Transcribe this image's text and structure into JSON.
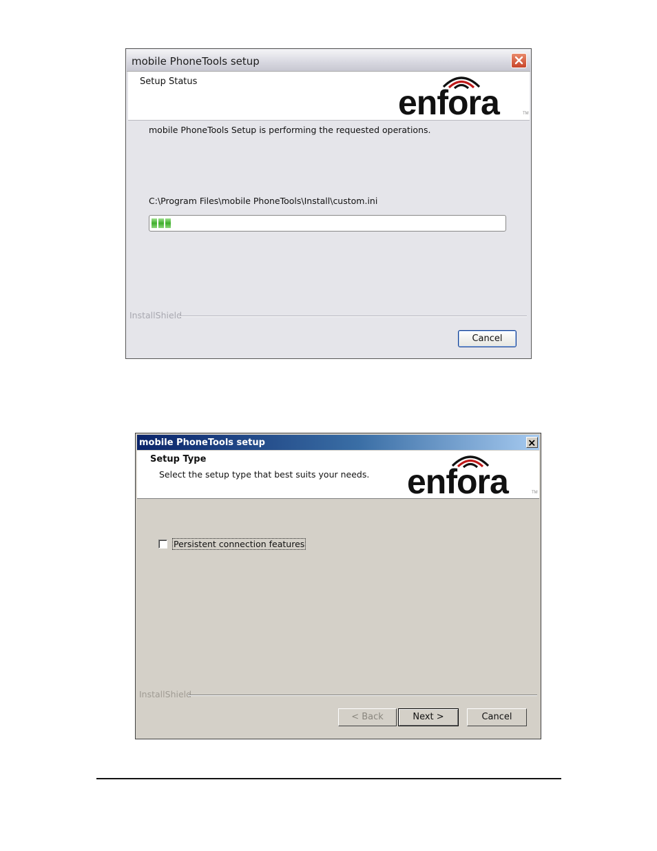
{
  "dialog1": {
    "title": "mobile PhoneTools setup",
    "header_title": "Setup Status",
    "logo_text": "enfora",
    "message": "mobile PhoneTools Setup is performing the requested operations.",
    "current_file": "C:\\Program Files\\mobile PhoneTools\\Install\\custom.ini",
    "progress_blocks": 3,
    "footer_brand": "InstallShield",
    "cancel_label": "Cancel"
  },
  "dialog2": {
    "title": "mobile PhoneTools setup",
    "header_title": "Setup Type",
    "header_subtitle": "Select the setup type that best suits your needs.",
    "logo_text": "enfora",
    "checkbox_label": "Persistent connection features",
    "checkbox_checked": false,
    "footer_brand": "InstallShield",
    "back_label": "< Back",
    "next_label": "Next >",
    "cancel_label": "Cancel"
  },
  "colors": {
    "xp_close_red": "#c8452a",
    "classic_title_blue": "#0a246a",
    "progress_green": "#4fbf3a"
  }
}
